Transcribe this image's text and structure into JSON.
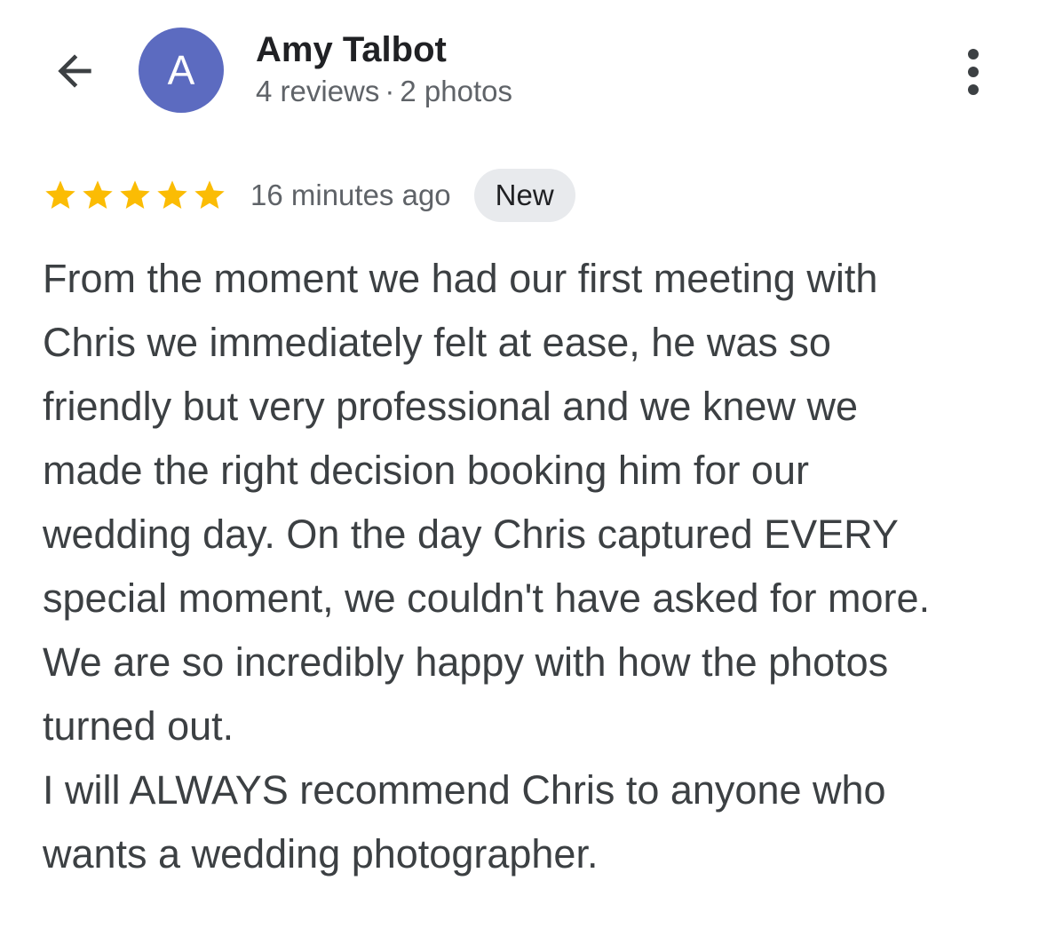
{
  "header": {
    "back_icon": "arrow-back-icon",
    "avatar": {
      "initial": "A",
      "color": "#5c6bc0"
    },
    "user_name": "Amy Talbot",
    "reviews_count": "4 reviews",
    "separator": "·",
    "photos_count": "2 photos",
    "more_icon": "more-vertical-icon"
  },
  "review": {
    "rating": 5,
    "rating_max": 5,
    "star_color": "#fbbc04",
    "time_ago": "16 minutes ago",
    "badge": {
      "label": "New",
      "background": "#e8eaed"
    },
    "lines": [
      "From the moment we had our first meeting with",
      "Chris we immediately felt at ease, he was so",
      "friendly but very professional and we knew we",
      "made the right decision booking him for our",
      "wedding day. On the day Chris captured EVERY",
      "special moment, we couldn't have asked for more.",
      "We are so incredibly happy with how the photos",
      "turned out.",
      "I will ALWAYS recommend Chris to anyone who",
      "wants a wedding photographer."
    ]
  }
}
